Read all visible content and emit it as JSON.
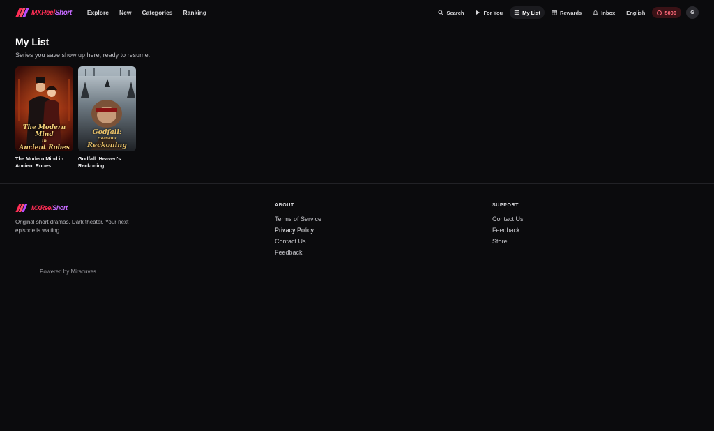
{
  "brand": {
    "name_a": "MXReel",
    "name_b": "Short"
  },
  "nav_left": [
    "Explore",
    "New",
    "Categories",
    "Ranking"
  ],
  "nav_right": {
    "search": "Search",
    "for_you": "For You",
    "my_list": "My List",
    "rewards": "Rewards",
    "inbox": "Inbox",
    "language": "English",
    "coins": "5000",
    "avatar": "G"
  },
  "page": {
    "title": "My List",
    "subtitle": "Series you save show up here, ready to resume."
  },
  "series": [
    {
      "title": "The Modern Mind in Ancient Robes",
      "poster_text": [
        "The Modern Mind",
        "in",
        "Ancient Robes"
      ]
    },
    {
      "title": "Godfall: Heaven's Reckoning",
      "poster_text": [
        "Godfall:",
        "Heaven's",
        "Reckoning"
      ]
    }
  ],
  "footer": {
    "tagline": "Original short dramas. Dark theater. Your next episode is waiting.",
    "powered_by": "Powered by Miracuves",
    "about": {
      "heading": "ABOUT",
      "links": [
        "Terms of Service",
        "Privacy Policy",
        "Contact Us",
        "Feedback"
      ]
    },
    "support": {
      "heading": "SUPPORT",
      "links": [
        "Contact Us",
        "Feedback",
        "Store"
      ]
    }
  },
  "colors": {
    "background": "#0b0b0d",
    "brand_red": "#ff2d55",
    "brand_purple": "#c76bff",
    "coin_pill": "#3a1216"
  }
}
